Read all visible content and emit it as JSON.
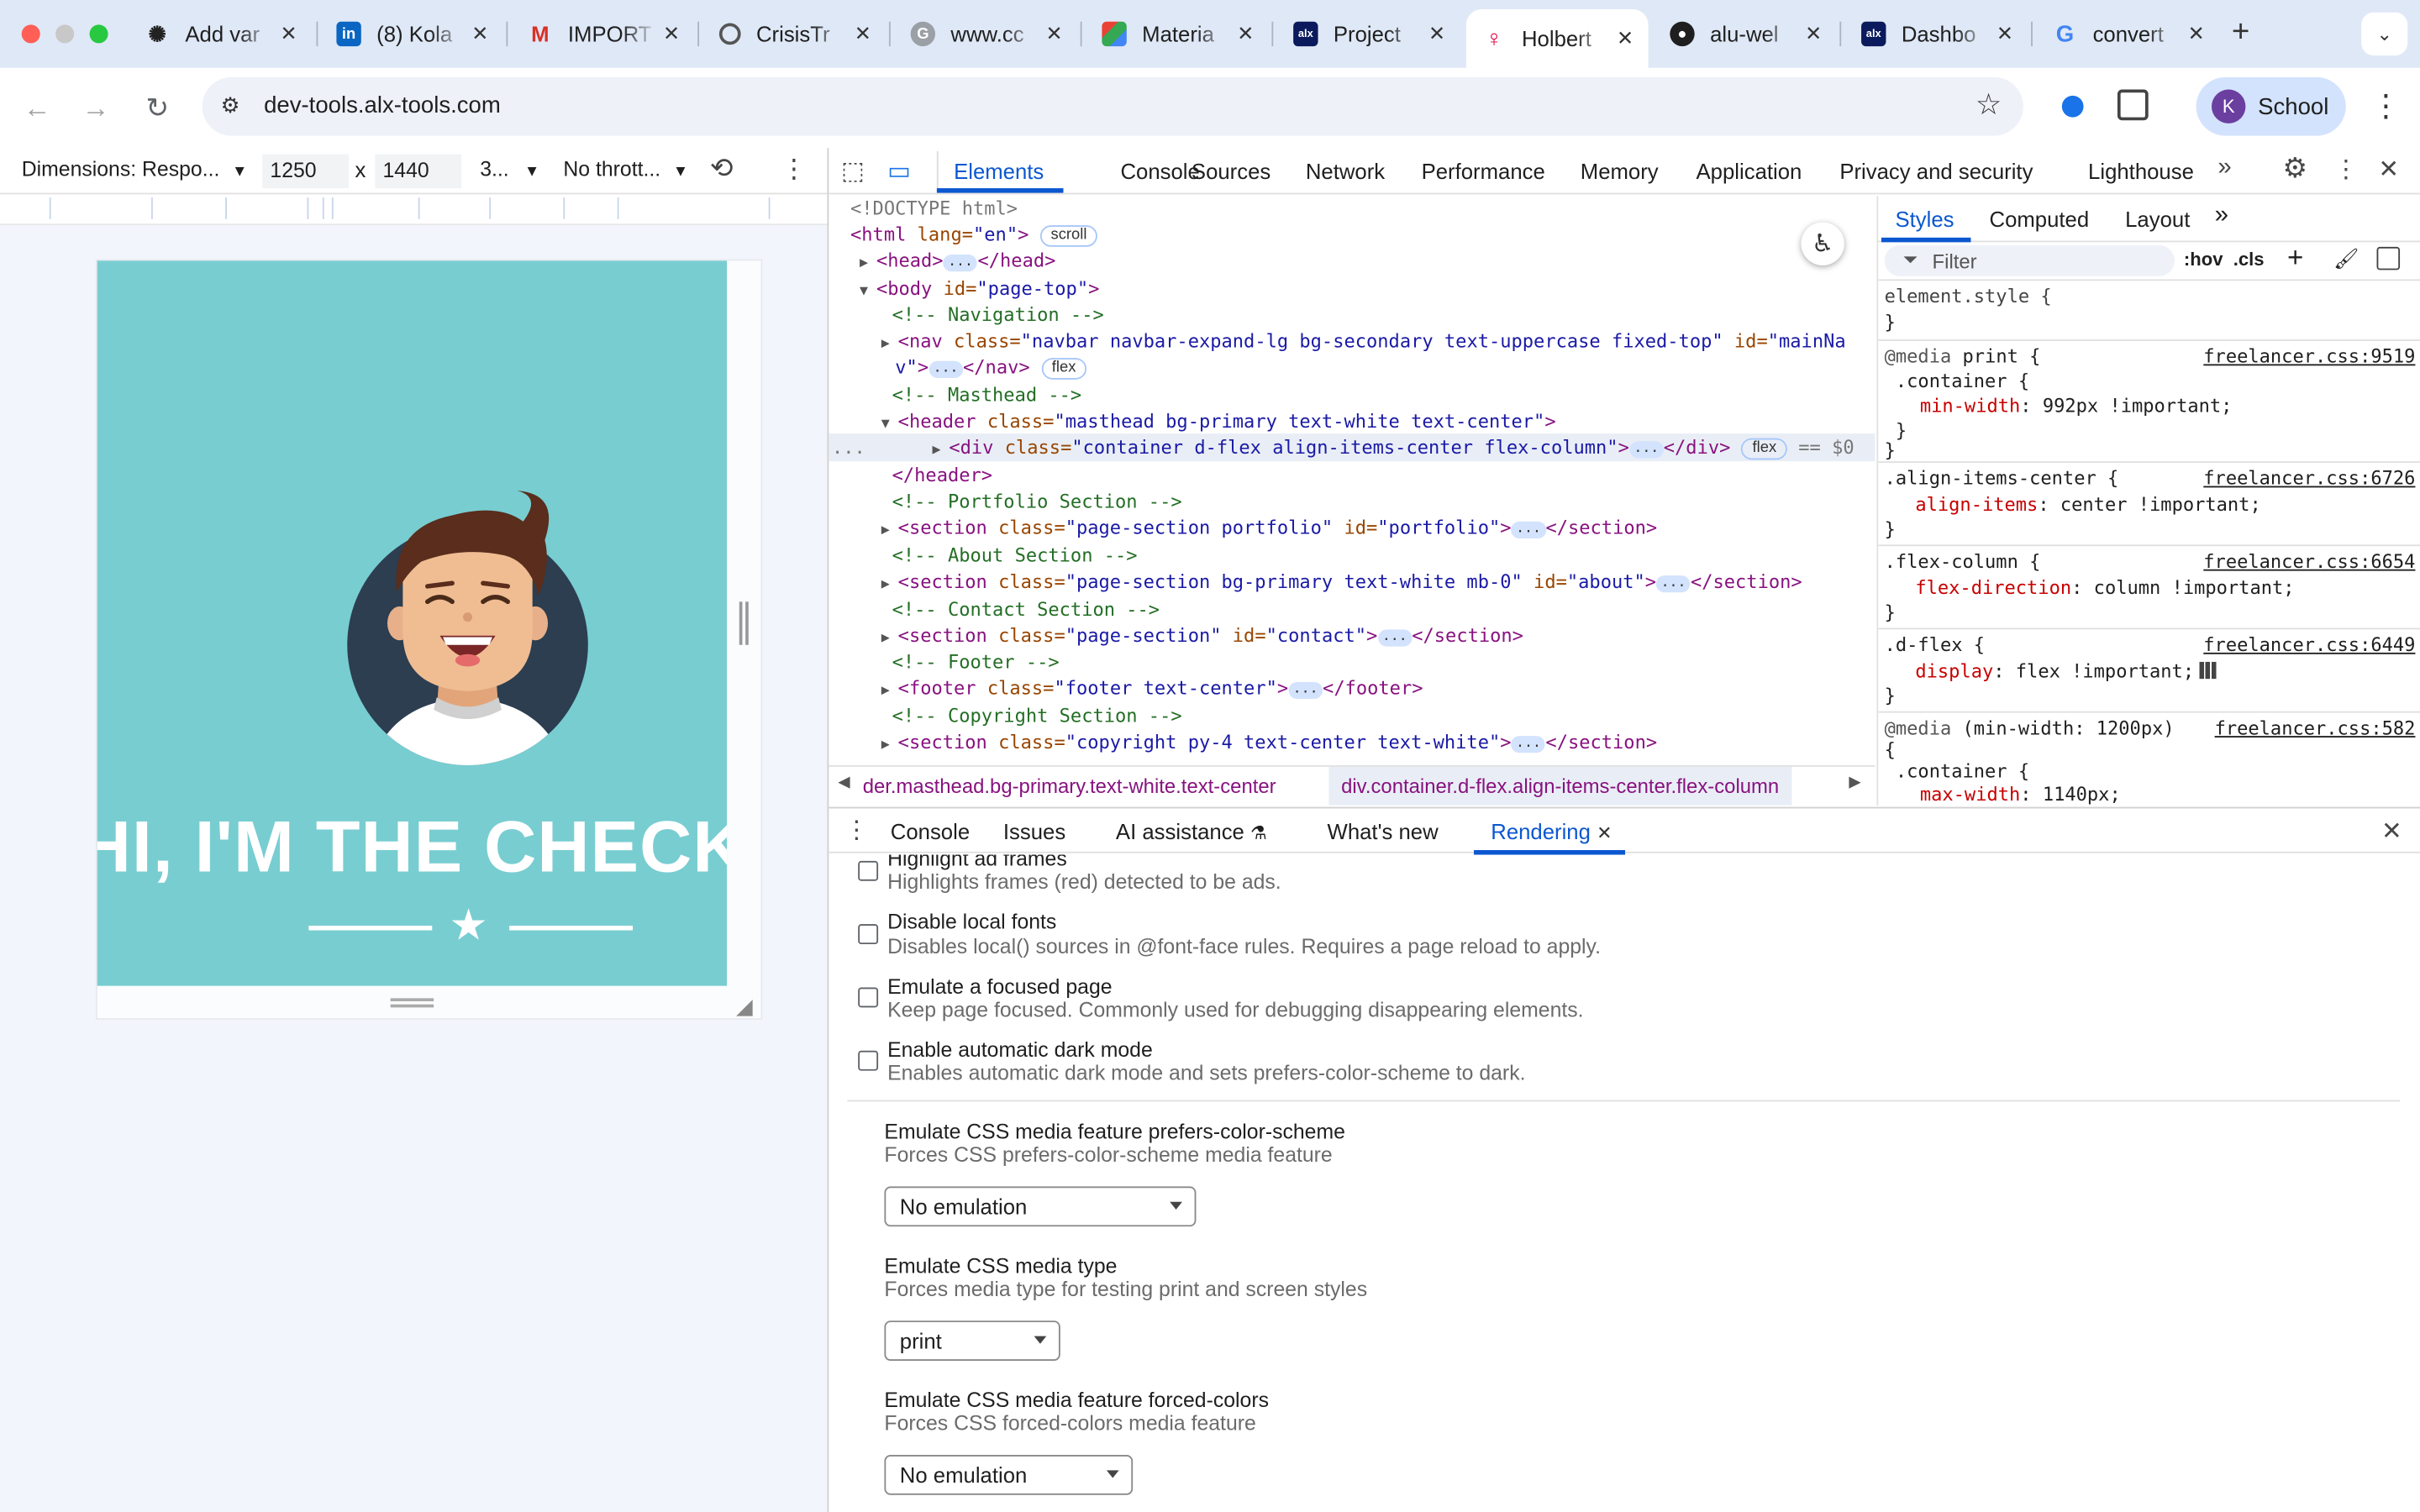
{
  "browser": {
    "tabs": [
      {
        "title": "Add var",
        "icon": "openai-icon"
      },
      {
        "title": "(8) Kola",
        "icon": "linkedin-icon"
      },
      {
        "title": "IMPORT",
        "icon": "gmail-icon"
      },
      {
        "title": "CrisisTr",
        "icon": "globe-icon"
      },
      {
        "title": "www.cc",
        "icon": "grammarly-icon"
      },
      {
        "title": "Materia",
        "icon": "materia-icon"
      },
      {
        "title": "Project",
        "icon": "alx-icon"
      },
      {
        "title": "Holbert",
        "icon": "holberton-icon",
        "active": true
      },
      {
        "title": "alu-wel",
        "icon": "github-icon"
      },
      {
        "title": "Dashbo",
        "icon": "alx-icon"
      },
      {
        "title": "convert",
        "icon": "google-icon"
      }
    ],
    "url": "dev-tools.alx-tools.com",
    "profile_name": "School",
    "profile_initial": "K"
  },
  "device_toolbar": {
    "dimensions_label": "Dimensions: Respo...",
    "width": "1250",
    "height": "1440",
    "times": "x",
    "zoom": "3...",
    "throttle": "No thrott..."
  },
  "page": {
    "hero_text": "HI, I'M THE CHECK",
    "bg_color": "#78cdd1"
  },
  "devtools": {
    "tabs": [
      "Elements",
      "Console",
      "Sources",
      "Network",
      "Performance",
      "Memory",
      "Application",
      "Privacy and security",
      "Lighthouse"
    ],
    "active_tab": "Elements",
    "dom_lines": {
      "doctype": "<!DOCTYPE html>",
      "html_open": "<html",
      "lang_attr": " lang=",
      "lang_val": "\"en\"",
      "gt": ">",
      "scroll_pill": "scroll",
      "head_open": "<head>",
      "head_close": "</head>",
      "body_open": "<body",
      "body_id_attr": " id=",
      "body_id_val": "\"page-top\"",
      "comment_nav": "<!-- Navigation -->",
      "nav_open": "<nav",
      "class_attr": " class=",
      "nav_class": "\"navbar navbar-expand-lg bg-secondary text-uppercase fixed-top\"",
      "id_attr": " id=",
      "nav_id_a": "\"mainNa",
      "nav_id_b": "v\"",
      "nav_close": "</nav>",
      "flex_pill": "flex",
      "comment_masthead": "<!-- Masthead -->",
      "header_open": "<header",
      "header_class": "\"masthead bg-primary text-white text-center\"",
      "div_open": "<div",
      "div_class": "\"container d-flex align-items-center flex-column\"",
      "div_close": "</div>",
      "eq_sel": "== $0",
      "header_close": "</header>",
      "comment_portfolio": "<!-- Portfolio Section -->",
      "section_open": "<section",
      "portfolio_class": "\"page-section portfolio\"",
      "portfolio_id": "\"portfolio\"",
      "section_close": "</section>",
      "comment_about": "<!-- About Section -->",
      "about_class": "\"page-section bg-primary text-white mb-0\"",
      "about_id": "\"about\"",
      "comment_contact": "<!-- Contact Section -->",
      "contact_class": "\"page-section\"",
      "contact_id": "\"contact\"",
      "comment_footer": "<!-- Footer -->",
      "footer_open": "<footer",
      "footer_class": "\"footer text-center\"",
      "footer_close": "</footer>",
      "comment_copyright": "<!-- Copyright Section -->",
      "copyright_class": "\"copyright py-4 text-center text-white\"",
      "dots": "..."
    },
    "breadcrumbs": [
      "der.masthead.bg-primary.text-white.text-center",
      "div.container.d-flex.align-items-center.flex-column"
    ],
    "styles_tabs": [
      "Styles",
      "Computed",
      "Layout"
    ],
    "filter_placeholder": "Filter",
    "hov": ":hov",
    "cls": ".cls",
    "styles": {
      "element_style": "element.style {",
      "close_brace": "}",
      "media_print_kw": "@media",
      "media_print_rest": " print {",
      "container_sel": " .container {",
      "min_width_prop": "min-width",
      "min_width_val": ": 992px !important;",
      "inner_close": " }",
      "src1": "freelancer.css:9519",
      "align_sel": ".align-items-center {",
      "align_prop": "align-items",
      "align_val": ": center !important;",
      "src2": "freelancer.css:6726",
      "flexcol_sel": ".flex-column {",
      "flexcol_prop": "flex-direction",
      "flexcol_val": ": column !important;",
      "src3": "freelancer.css:6654",
      "dflex_sel": ".d-flex {",
      "dflex_prop": "display",
      "dflex_val": ": flex !important;",
      "src4": "freelancer.css:6449",
      "media_min_kw": "@media",
      "media_min_rest": " (min-width: 1200px)",
      "open_brace": "{",
      "container_sel2": " .container {",
      "max_width_prop": "max-width",
      "max_width_val": ": 1140px;",
      "src5": "freelancer.css:582"
    },
    "drawer_tabs": [
      "Console",
      "Issues",
      "AI assistance",
      "What's new",
      "Rendering"
    ],
    "drawer_active": "Rendering",
    "rendering": {
      "options": [
        {
          "title": "Highlight ad frames",
          "desc": "Highlights frames (red) detected to be ads.",
          "checked": false
        },
        {
          "title": "Disable local fonts",
          "desc": "Disables local() sources in @font-face rules. Requires a page reload to apply.",
          "checked": false
        },
        {
          "title": "Emulate a focused page",
          "desc": "Keep page focused. Commonly used for debugging disappearing elements.",
          "checked": false
        },
        {
          "title": "Enable automatic dark mode",
          "desc": "Enables automatic dark mode and sets prefers-color-scheme to dark.",
          "checked": false
        }
      ],
      "media": [
        {
          "title": "Emulate CSS media feature prefers-color-scheme",
          "desc": "Forces CSS prefers-color-scheme media feature",
          "value": "No emulation"
        },
        {
          "title": "Emulate CSS media type",
          "desc": "Forces media type for testing print and screen styles",
          "value": "print"
        },
        {
          "title": "Emulate CSS media feature forced-colors",
          "desc": "Forces CSS forced-colors media feature",
          "value": "No emulation"
        }
      ]
    }
  }
}
